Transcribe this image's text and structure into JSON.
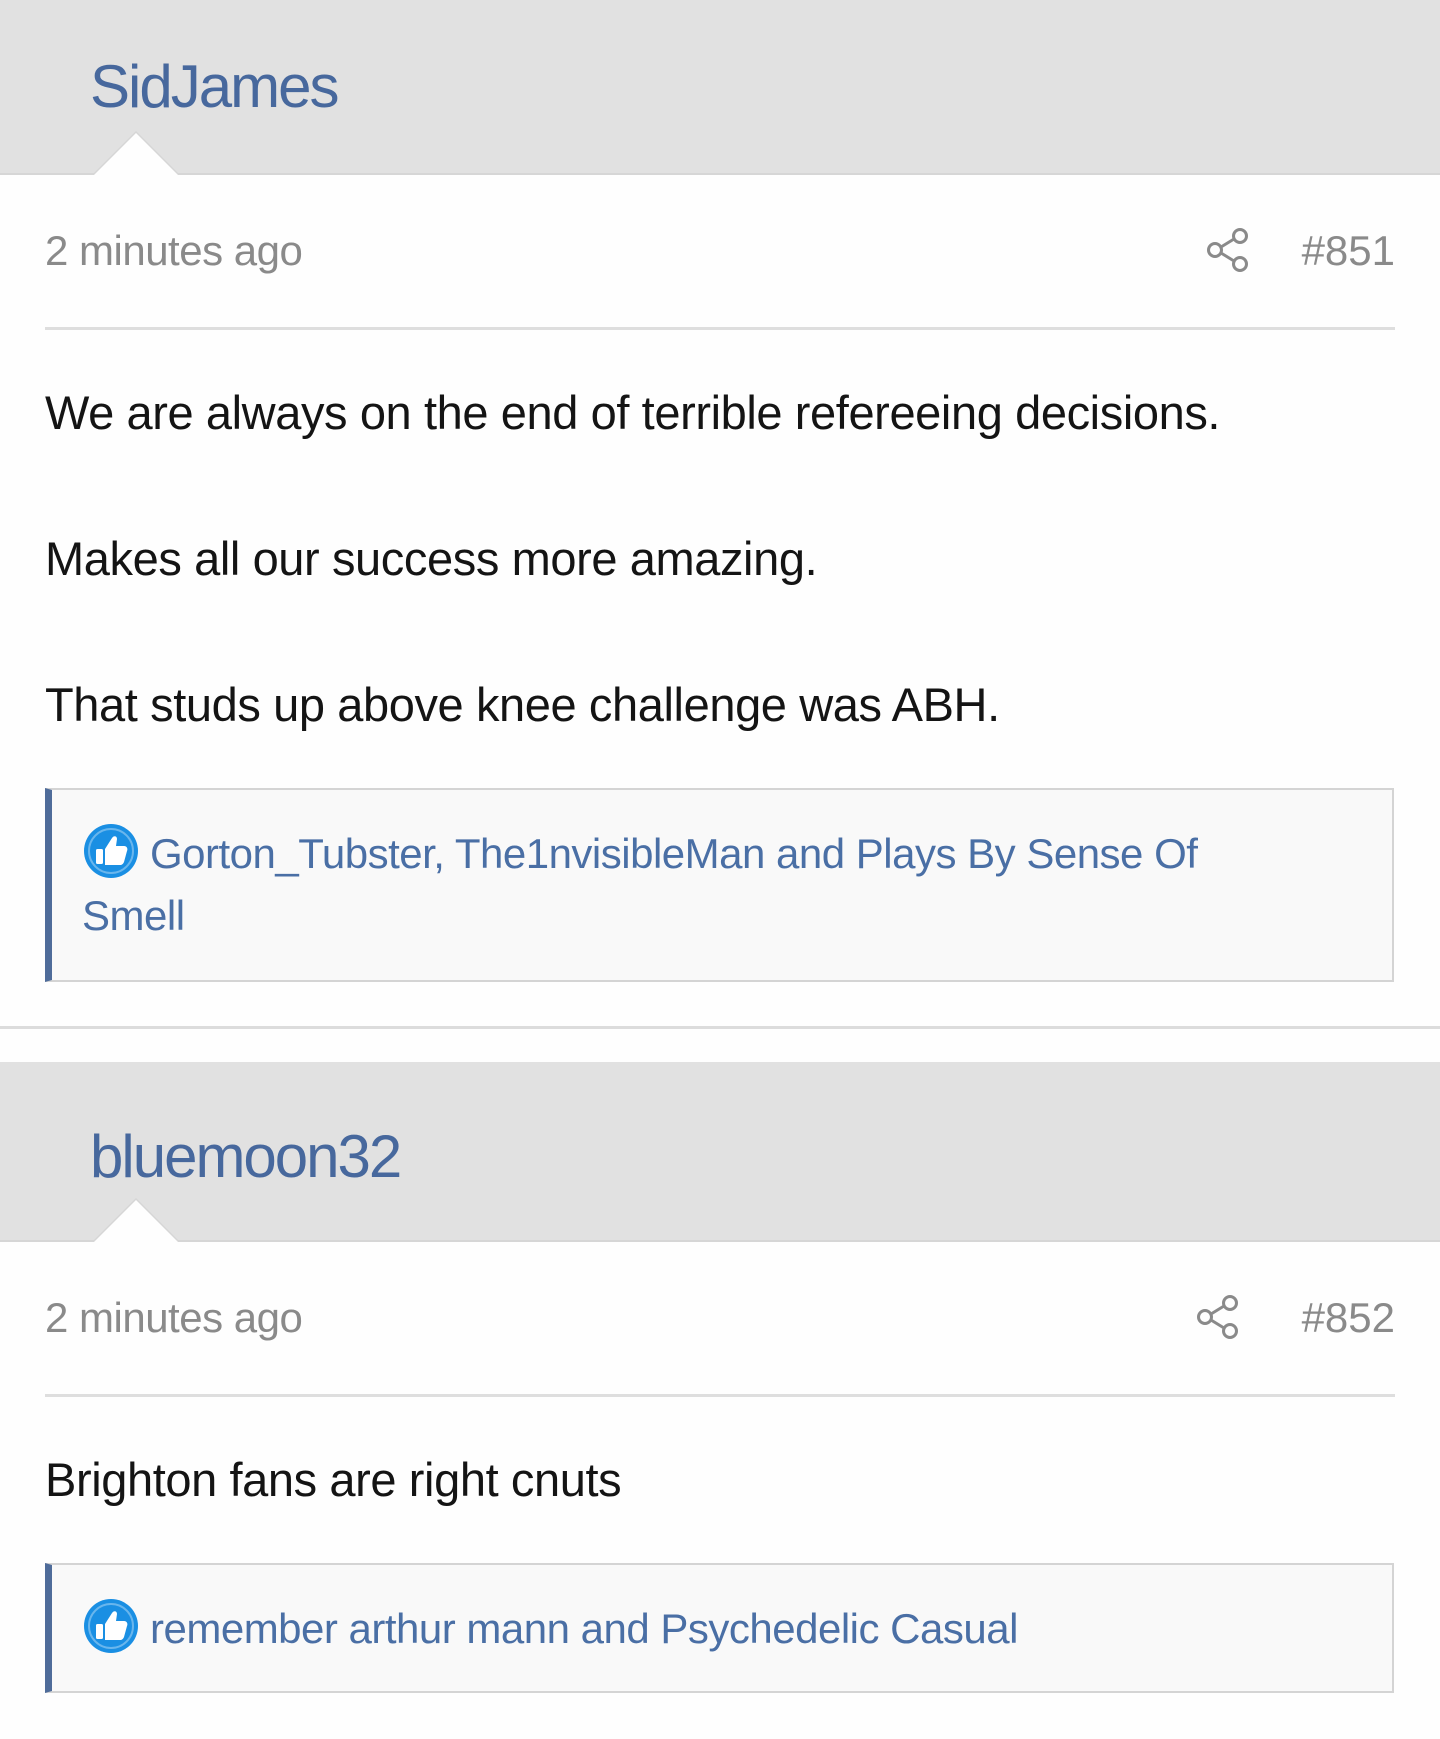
{
  "posts": [
    {
      "username": "SidJames",
      "timestamp": "2 minutes ago",
      "post_number": "#851",
      "message": [
        "We are always on the end of terrible refereeing decisions.",
        "Makes all our success more amazing.",
        "That studs up above knee challenge was ABH."
      ],
      "likes": "Gorton_Tubster, The1nvisibleMan and Plays By Sense Of Smell"
    },
    {
      "username": "bluemoon32",
      "timestamp": "2 minutes ago",
      "post_number": "#852",
      "message": [
        "Brighton fans are right cnuts"
      ],
      "likes": "remember arthur mann and Psychedelic Casual"
    }
  ],
  "icons": {
    "share": "share-icon",
    "like": "thumbs-up-icon"
  },
  "colors": {
    "username": "#47689d",
    "header_bg": "#e1e1e1",
    "likes_accent": "#4f6c9a",
    "like_icon": "#1a8fe3",
    "meta_text": "#8a8a8a"
  }
}
